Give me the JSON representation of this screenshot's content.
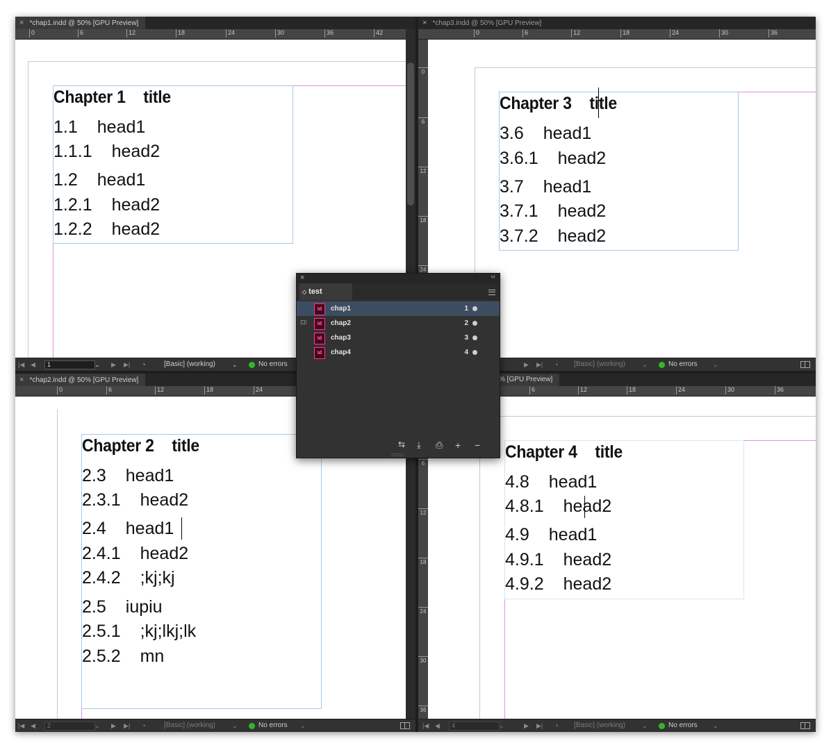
{
  "windows": {
    "chap1": {
      "tab": "*chap1.indd @ 50% [GPU Preview]",
      "ruler": [
        "0",
        "6",
        "12",
        "18",
        "24",
        "30",
        "36",
        "42"
      ],
      "status": {
        "page": "1",
        "profile": "[Basic] (working)",
        "errors": "No errors"
      },
      "title": "Chapter 1\ttitle",
      "lines": [
        "1.1\thead1",
        "1.1.1\thead2",
        "1.2\thead1",
        "1.2.1\thead2",
        "1.2.2\thead2"
      ]
    },
    "chap3": {
      "tab": "*chap3.indd @ 50% [GPU Preview]",
      "ruler": [
        "0",
        "6",
        "12",
        "18",
        "24",
        "30",
        "36"
      ],
      "vruler": [
        "0",
        "6",
        "12",
        "18",
        "24"
      ],
      "status": {
        "profile": "[Basic] (working)",
        "errors": "No errors"
      },
      "title": "Chapter 3\ttitle",
      "lines": [
        "3.6\thead1",
        "3.6.1\thead2",
        "3.7\thead1",
        "3.7.1\thead2",
        "3.7.2\thead2"
      ]
    },
    "chap2": {
      "tab": "*chap2.indd @ 50% [GPU Preview]",
      "ruler": [
        "0",
        "6",
        "12",
        "18",
        "24"
      ],
      "status": {
        "page": "2",
        "profile": "[Basic] (working)",
        "errors": "No errors"
      },
      "title": "Chapter 2\ttitle",
      "lines": [
        "2.3\thead1",
        "2.3.1\thead2",
        "2.4\thead1",
        "2.4.1\thead2",
        "2.4.2\t;kj;kj",
        "2.5\tiupiu",
        "2.5.1\t;kj;lkj;lk",
        "2.5.2\tmn"
      ]
    },
    "chap4": {
      "tab": "% [GPU Preview]",
      "ruler": [
        "6",
        "12",
        "18",
        "24",
        "30",
        "36"
      ],
      "vruler": [
        "6",
        "12",
        "18",
        "24",
        "30",
        "36"
      ],
      "status": {
        "page": "4",
        "profile": "[Basic] (working)",
        "errors": "No errors"
      },
      "title": "Chapter 4\ttitle",
      "lines": [
        "4.8\thead1",
        "4.8.1\thead2",
        "4.9\thead1",
        "4.9.1\thead2",
        "4.9.2\thead2"
      ]
    }
  },
  "book_panel": {
    "tab": "test",
    "documents": [
      {
        "name": "chap1",
        "pages": "1",
        "selected": true
      },
      {
        "name": "chap2",
        "pages": "2",
        "selected": false
      },
      {
        "name": "chap3",
        "pages": "3",
        "selected": false
      },
      {
        "name": "chap4",
        "pages": "4",
        "selected": false
      }
    ],
    "doc_icon": "Id",
    "footer_icons": [
      "synchronize-icon",
      "add-document-icon",
      "print-icon",
      "plus-icon",
      "minus-icon"
    ]
  },
  "colors": {
    "margin": "#e38ee3",
    "frame_edge": "#a8c8e8",
    "selected_row": "#3d4d61",
    "status_ok": "#2fb82f"
  }
}
